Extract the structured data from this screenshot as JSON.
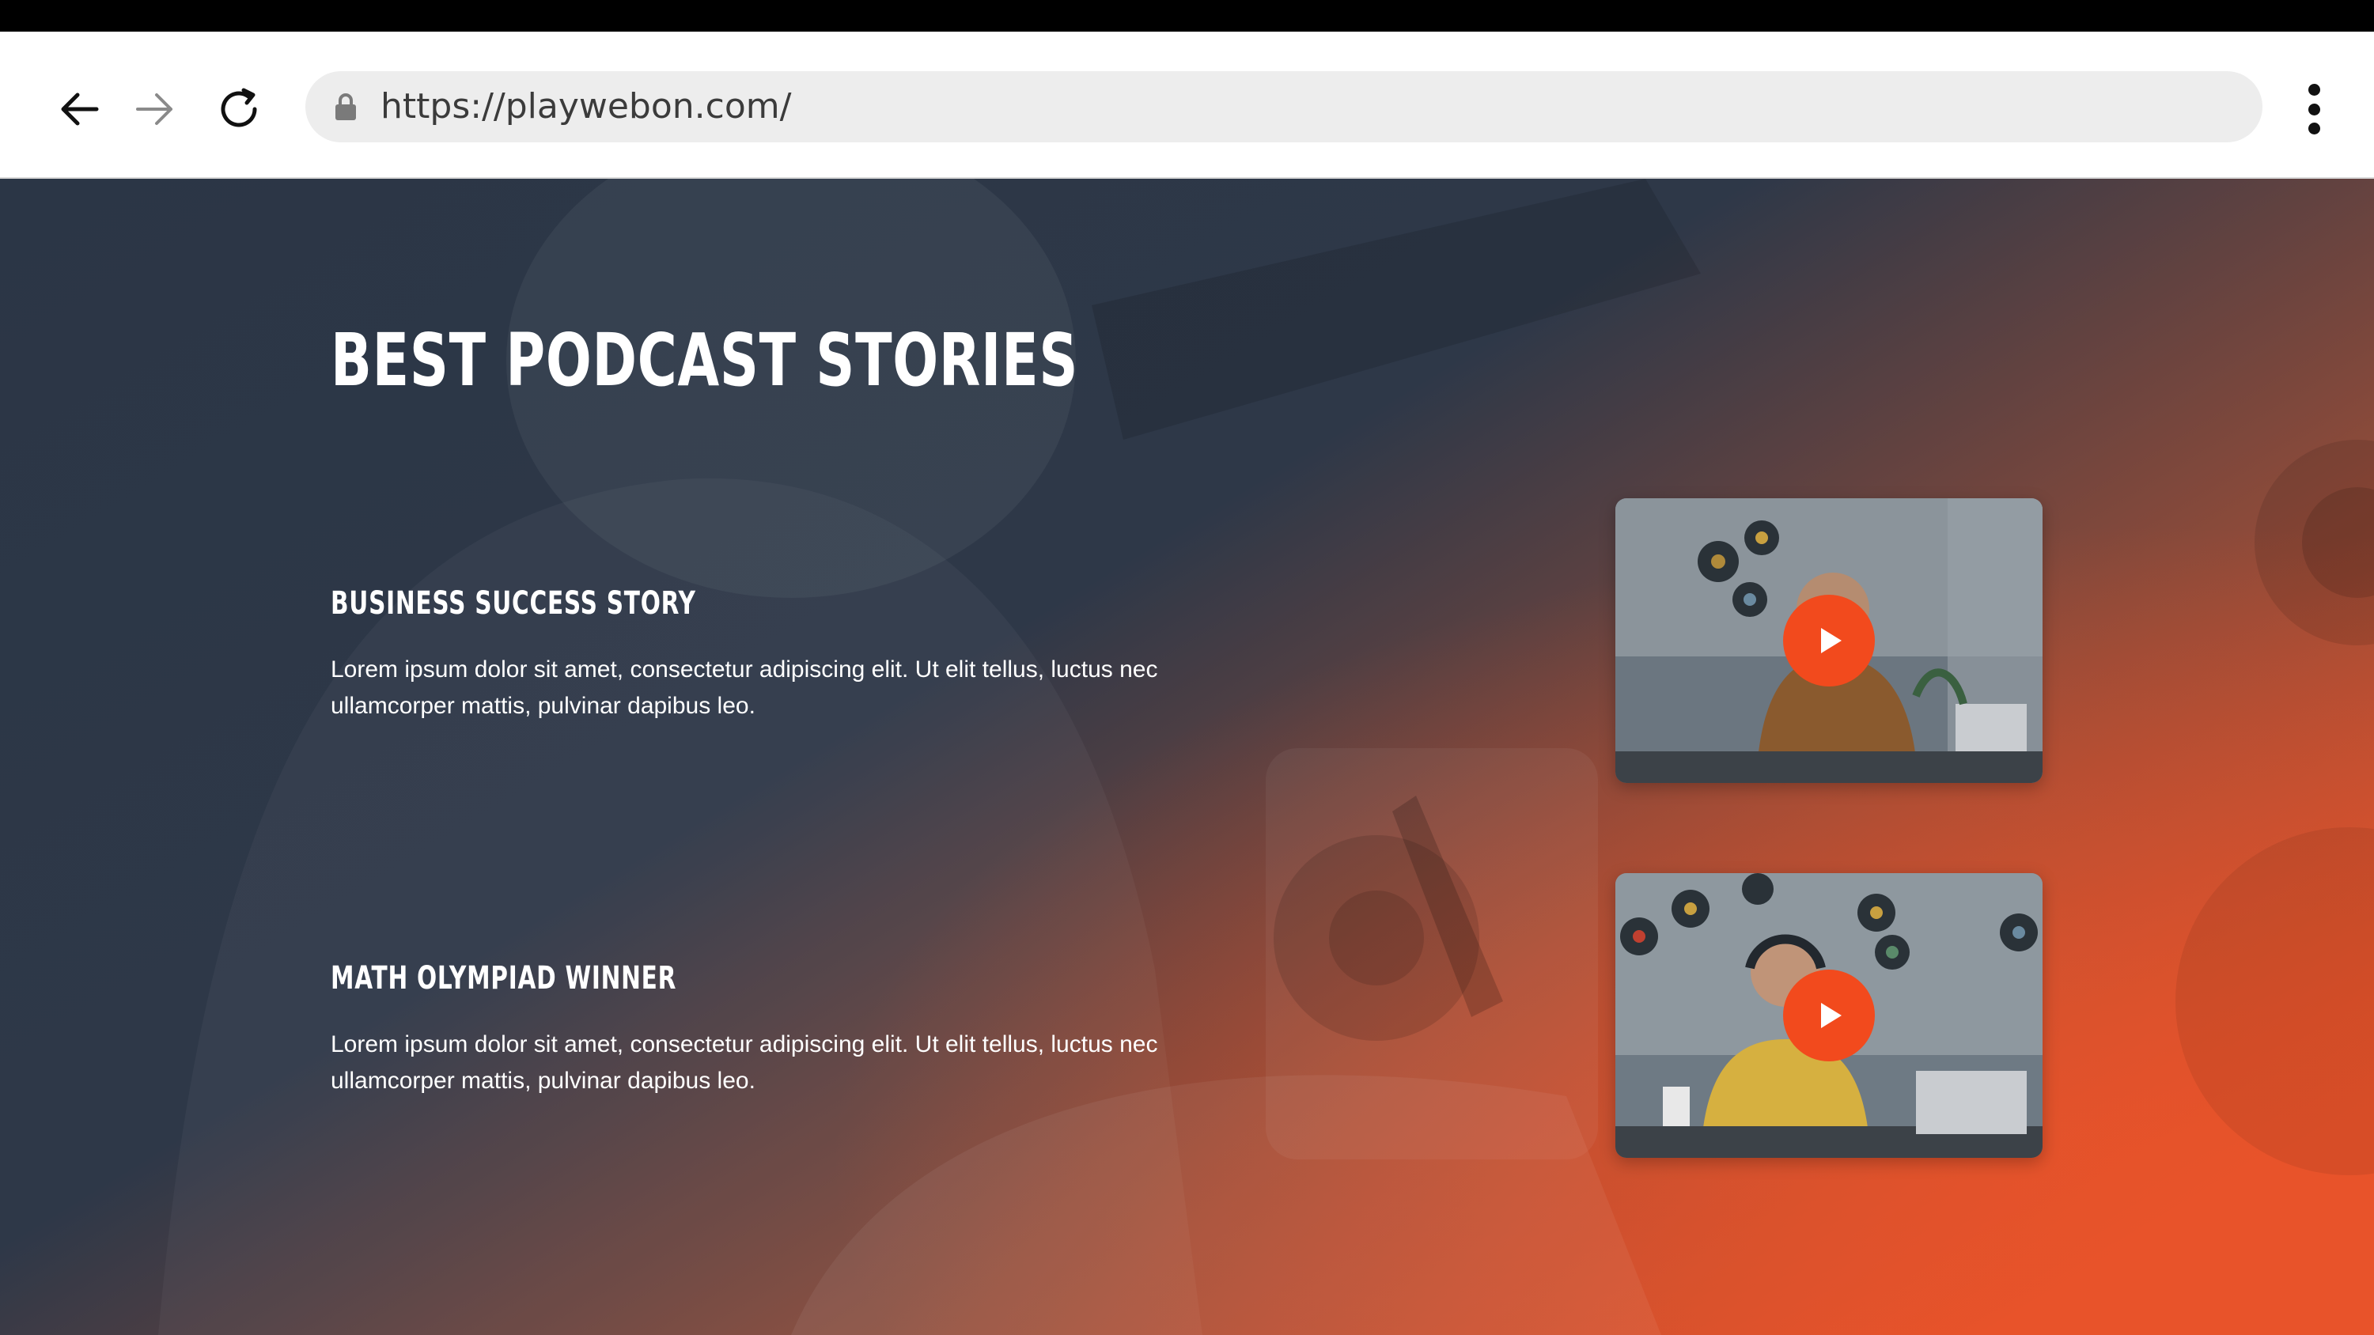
{
  "browser": {
    "url": "https://playwebon.com/",
    "back_icon": "arrow-left-icon",
    "forward_icon": "arrow-right-icon",
    "reload_icon": "reload-icon",
    "lock_icon": "lock-icon",
    "menu_icon": "kebab-menu-icon"
  },
  "page": {
    "section_title": "BEST PODCAST STORIES",
    "stories": [
      {
        "title": "BUSINESS SUCCESS STORY",
        "text": "Lorem ipsum dolor sit amet, consectetur adipiscing elit. Ut elit tellus, luctus nec ullamcorper mattis, pulvinar dapibus leo.",
        "video_icon": "play-icon"
      },
      {
        "title": "MATH OLYMPIAD WINNER",
        "text": "Lorem ipsum dolor sit amet, consectetur adipiscing elit. Ut elit tellus, luctus nec ullamcorper mattis, pulvinar dapibus leo.",
        "video_icon": "play-icon"
      }
    ]
  },
  "colors": {
    "accent": "#f24a1d",
    "overlay_dark": "#2b3646",
    "overlay_warm": "#e8532a",
    "address_bar": "#ededed"
  }
}
